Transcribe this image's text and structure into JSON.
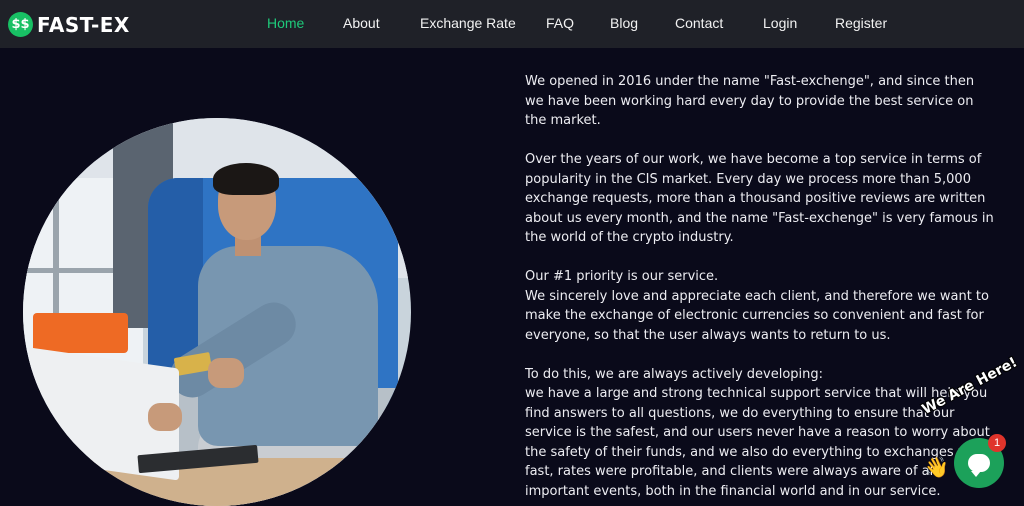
{
  "brand": {
    "logo_icon": "$$",
    "name": "FAST-EX"
  },
  "nav": {
    "items": [
      {
        "label": "Home",
        "active": true
      },
      {
        "label": "About",
        "active": false
      },
      {
        "label": "Exchange Rate",
        "active": false
      },
      {
        "label": "FAQ",
        "active": false
      },
      {
        "label": "Blog",
        "active": false
      },
      {
        "label": "Contact",
        "active": false
      },
      {
        "label": "Login",
        "active": false
      },
      {
        "label": "Register",
        "active": false
      }
    ]
  },
  "content": {
    "paragraphs": [
      "We opened in 2016 under the name \"Fast-exchenge\", and since then we have been working hard every day to provide the best service on the market.",
      "Over the years of our work, we have become a top service in terms of popularity in the CIS market. Every day we process more than 5,000 exchange requests, more than a thousand positive reviews are written about us every month, and the name \"Fast-exchenge\" is very famous in the world of the crypto industry.",
      "Our #1 priority is our service.",
      "We sincerely love and appreciate each client, and therefore we want to make the exchange of electronic currencies so convenient and fast for everyone, so that the user always wants to return to us.",
      "To do this, we are always actively developing:",
      "we have a large and strong technical support service that will help you find answers to all questions, we do everything to ensure that our service is the safest, and our users never have a reason to worry about the safety of their funds, and we also do everything to exchanges were fast, rates were profitable, and clients were always aware of all important events, both in the financial world and in our service."
    ]
  },
  "chat_widget": {
    "label": "We Are Here!",
    "icon": "chat-bubble-icon",
    "wave_icon": "waving-hand-icon",
    "badge_count": "1"
  },
  "colors": {
    "accent": "#1ec97a",
    "background": "#0a0a1a",
    "header": "#1f2128",
    "chat": "#1ca15a",
    "badge": "#e0342b"
  }
}
